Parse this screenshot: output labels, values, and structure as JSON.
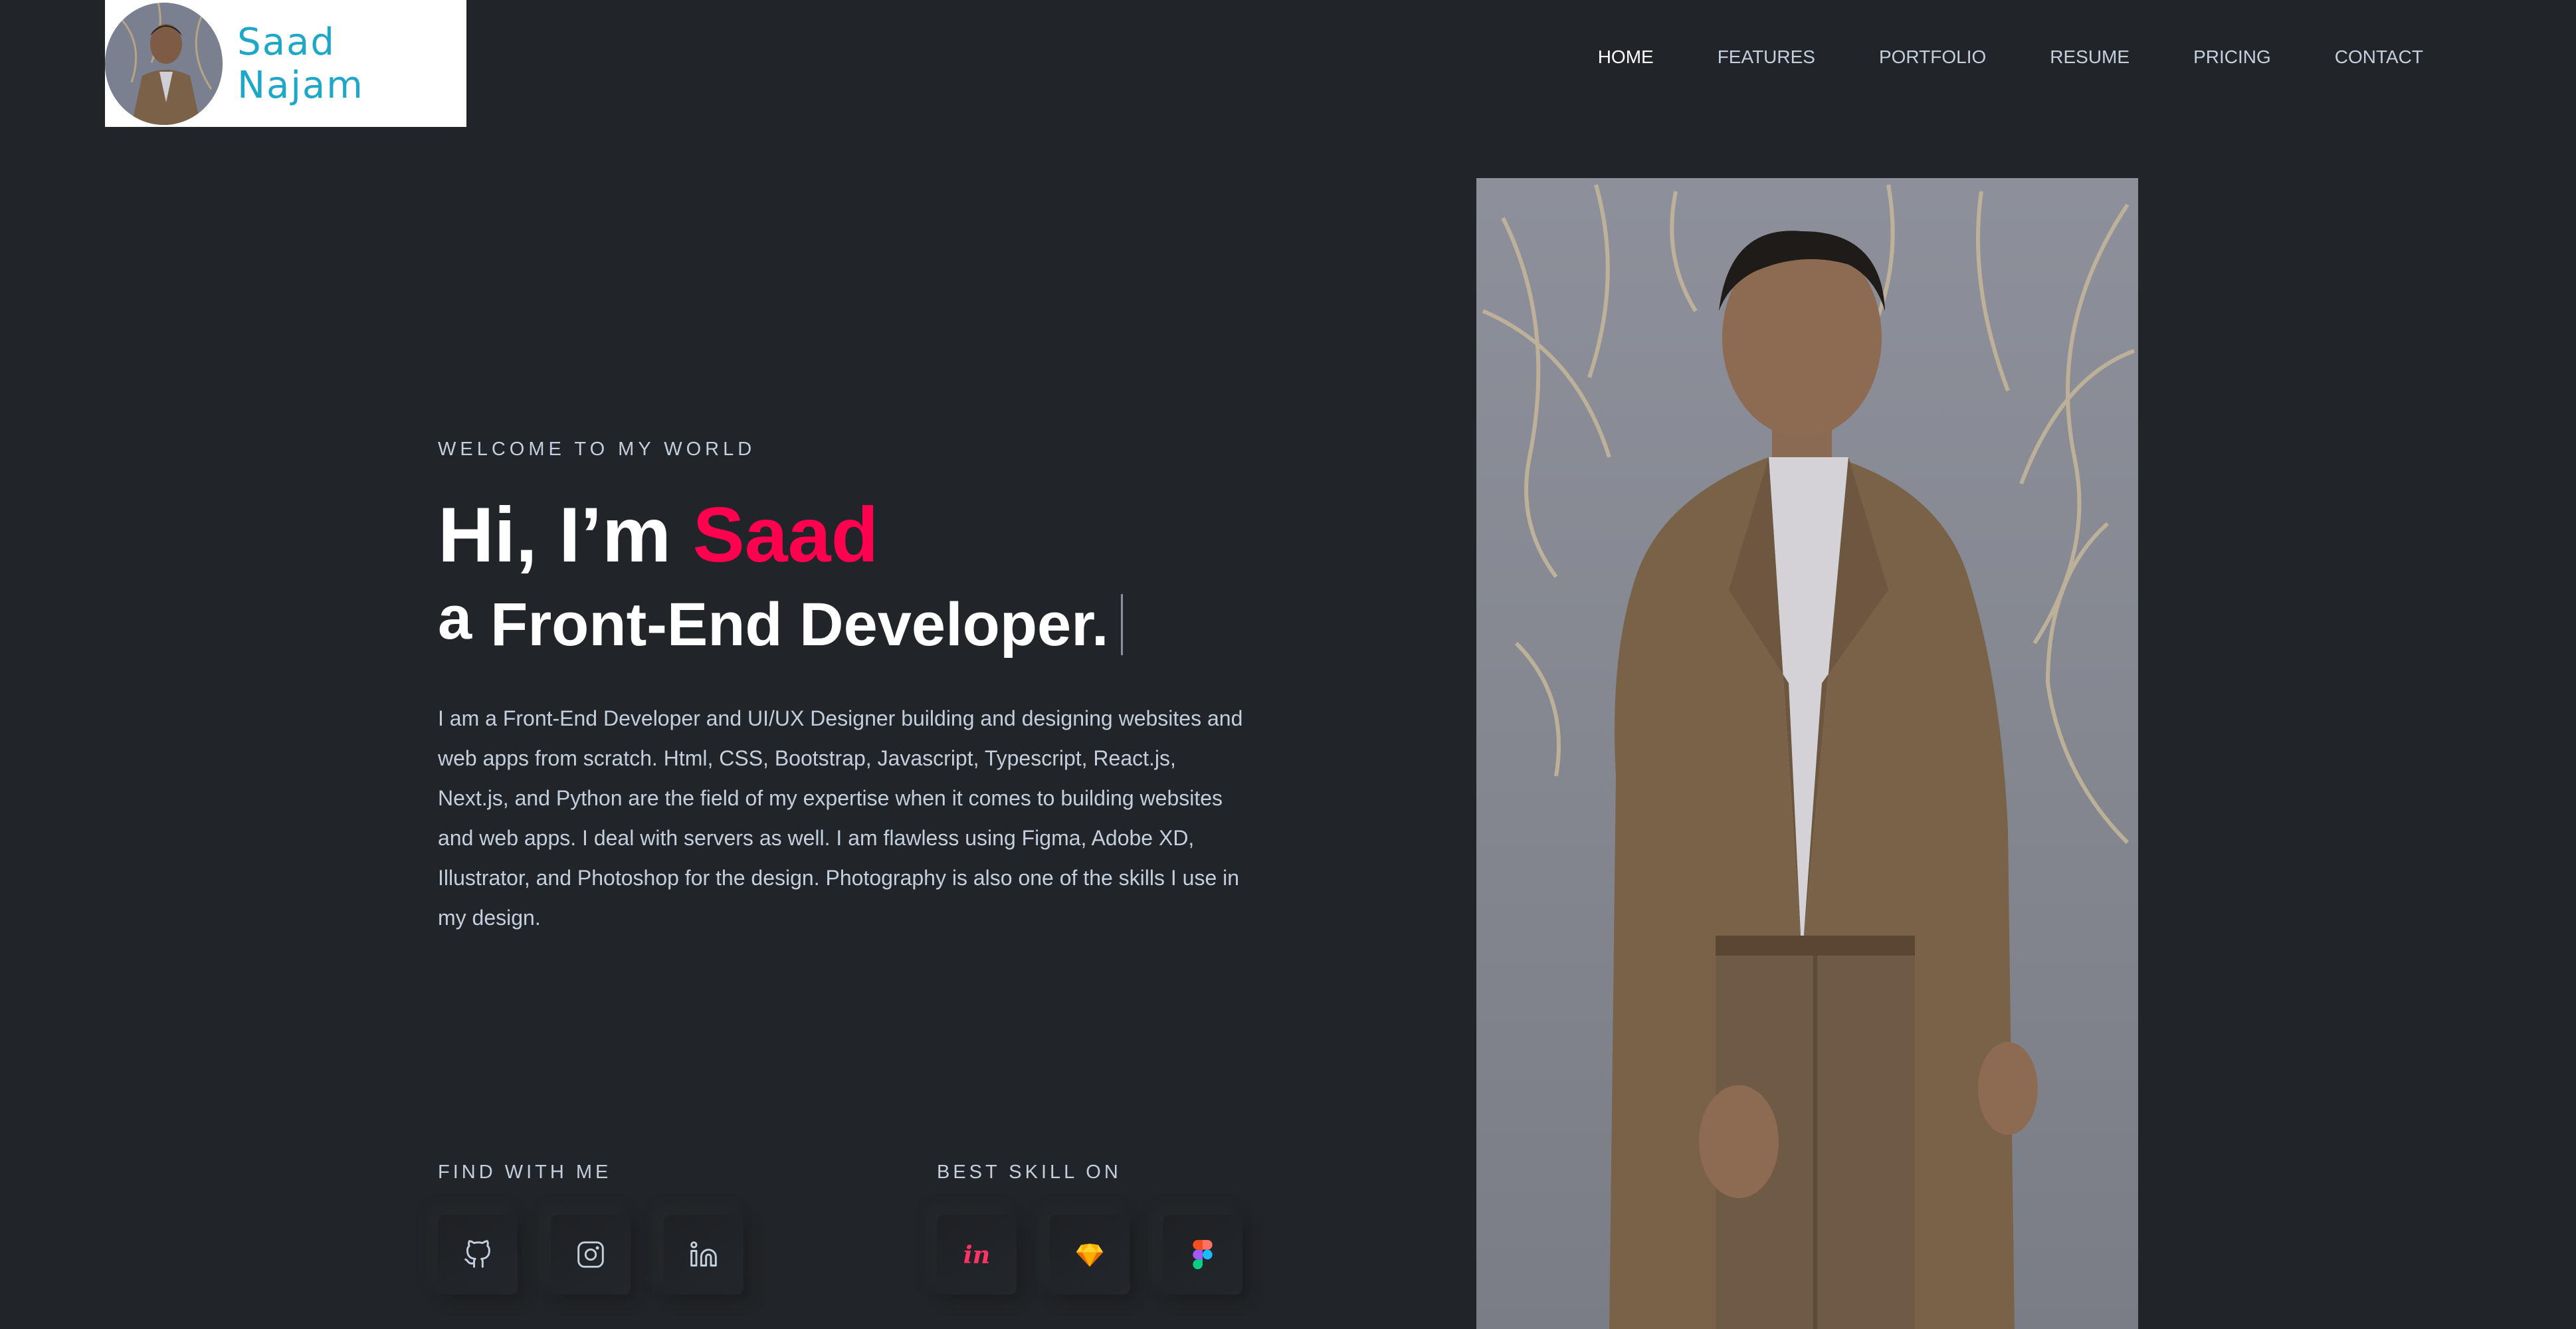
{
  "header": {
    "brand": "Saad Najam",
    "nav": [
      {
        "label": "HOME",
        "active": true
      },
      {
        "label": "FEATURES"
      },
      {
        "label": "PORTFOLIO"
      },
      {
        "label": "RESUME"
      },
      {
        "label": "PRICING"
      },
      {
        "label": "CONTACT"
      }
    ]
  },
  "hero": {
    "eyebrow": "WELCOME TO MY WORLD",
    "title_prefix": "Hi, I’m ",
    "title_name": "Saad",
    "subtitle_a": "a",
    "subtitle_role": "Front-End Developer.",
    "description": "I am a Front-End Developer and UI/UX Designer building and designing websites and web apps from scratch. Html, CSS, Bootstrap, Javascript, Typescript, React.js, Next.js, and Python are the field of my expertise when it comes to building websites and web apps. I deal with servers as well. I am flawless using Figma, Adobe XD, Illustrator, and Photoshop for the design. Photography is also one of the skills I use in my design."
  },
  "find_with_me": {
    "label": "FIND WITH ME",
    "icons": [
      "github-icon",
      "instagram-icon",
      "linkedin-icon"
    ]
  },
  "best_skill": {
    "label": "BEST SKILL ON",
    "icons": [
      "invision-icon",
      "sketch-icon",
      "figma-icon"
    ]
  },
  "colors": {
    "background": "#212428",
    "accent": "#ff014f",
    "brand": "#1ea7c7",
    "text": "#c4cfde"
  }
}
